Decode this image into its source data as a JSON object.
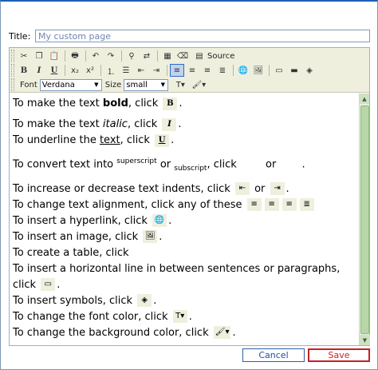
{
  "form": {
    "title_label": "Title:",
    "title_value": "My custom page"
  },
  "toolbar": {
    "source_label": "Source",
    "font_label": "Font",
    "font_value": "Verdana",
    "size_label": "Size",
    "size_value": "small"
  },
  "content": {
    "l1": {
      "a": "To make the text ",
      "b": "bold",
      "c": ", click "
    },
    "l2": {
      "a": "To make the text ",
      "b": "italic",
      "c": ", click "
    },
    "l3": {
      "a": "To underline the ",
      "b": "text",
      "c": ", click "
    },
    "l4": {
      "a": "To convert text into ",
      "b": "superscript",
      "c": " or ",
      "d": "subscript",
      "e": ", click ",
      "f": " or "
    },
    "l5": {
      "a": "To increase or decrease text indents, click ",
      "b": " or "
    },
    "l6": "To change text alignment, click any of these ",
    "l7": "To insert a hyperlink, click ",
    "l8": "To insert an image, click ",
    "l9": "To create a table, click ",
    "l10": "To insert a horizontal line in between sentences or paragraphs, click ",
    "l11": "To insert symbols, click ",
    "l12": "To change the font color, click ",
    "l13": "To change the background color, click ",
    "period": ".",
    "chip_bold": "B",
    "chip_italic": "I",
    "chip_underline": "U"
  },
  "buttons": {
    "cancel": "Cancel",
    "save": "Save"
  },
  "colors": {
    "toolbar_bg": "#efefde",
    "save_accent": "#c82020",
    "cancel_accent": "#2f5fa8"
  }
}
